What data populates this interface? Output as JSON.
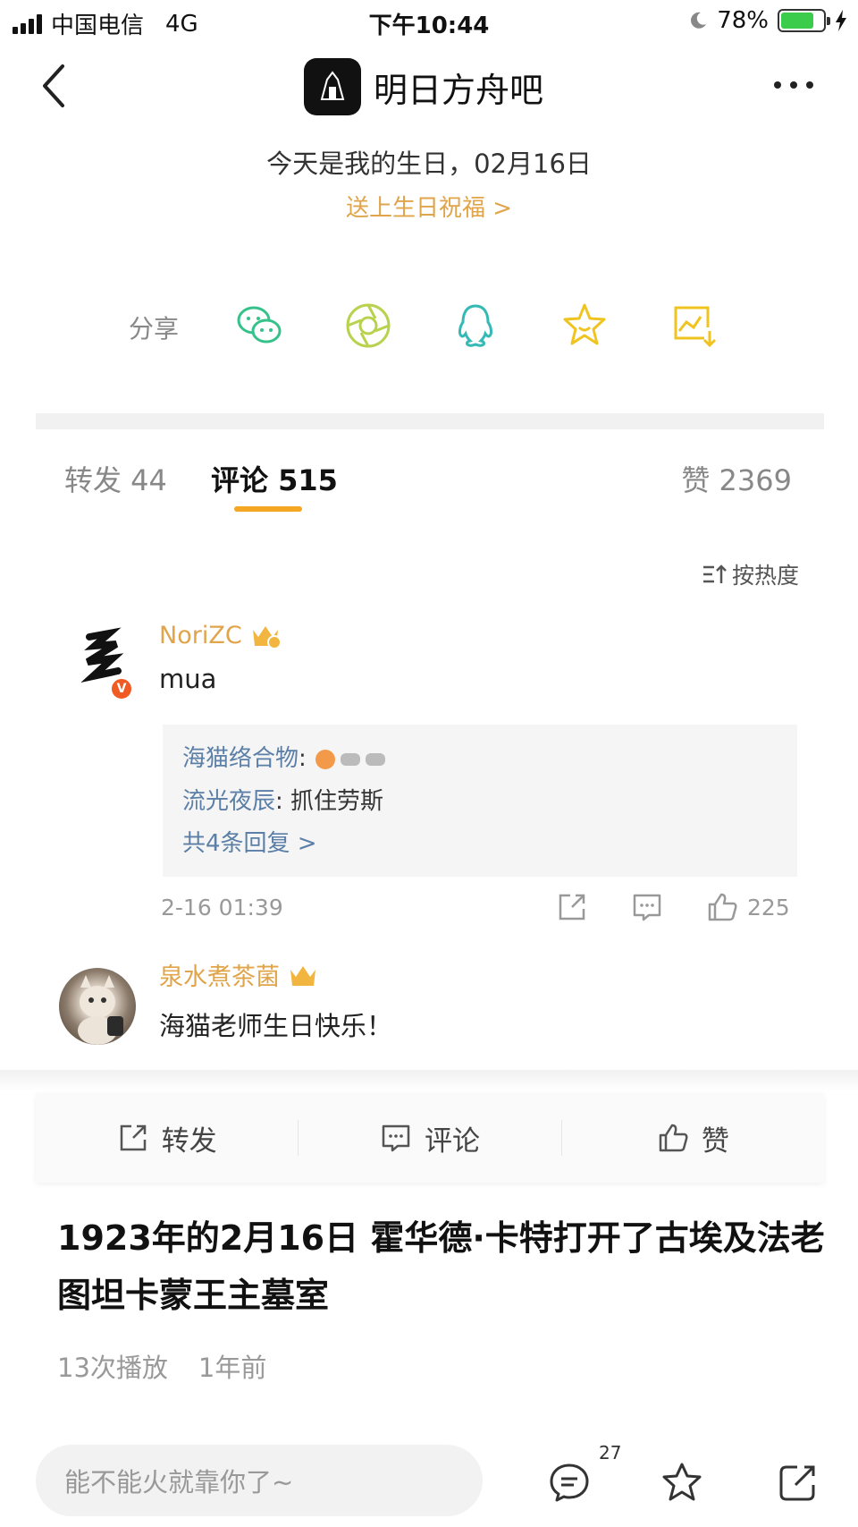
{
  "status_bar": {
    "carrier": "中国电信",
    "network": "4G",
    "time": "下午10:44",
    "battery": "78%",
    "battery_level": 0.78
  },
  "nav": {
    "title": "明日方舟吧"
  },
  "birthday": {
    "text": "今天是我的生日，02月16日",
    "link": "送上生日祝福 >"
  },
  "share": {
    "label": "分享",
    "icons": [
      "wechat-icon",
      "moments-icon",
      "qq-icon",
      "favorite-icon",
      "save-image-icon"
    ],
    "colors": {
      "green": "#35c28a",
      "lime": "#b8d24e",
      "teal": "#35b9b5",
      "yellow": "#f0c420"
    }
  },
  "tabs": {
    "repost": "转发 44",
    "comment": "评论 515",
    "like": "赞 2369"
  },
  "sort": {
    "label": "按热度"
  },
  "comments": [
    {
      "user": "NoriZC",
      "text": "mua",
      "replies": [
        {
          "name": "海猫络合物",
          "sep": ": ",
          "text": ""
        },
        {
          "name": "流光夜辰",
          "sep": ": ",
          "text": "抓住劳斯"
        }
      ],
      "more_replies": "共4条回复 >",
      "time": "2-16 01:39",
      "likes": "225"
    },
    {
      "user": "泉水煮茶菌",
      "text": "海猫老师生日快乐！"
    }
  ],
  "action_bar": {
    "repost": "转发",
    "comment": "评论",
    "like": "赞"
  },
  "article": {
    "title": "1923年的2月16日 霍华德·卡特打开了古埃及法老图坦卡蒙王主墓室",
    "plays": "13次播放",
    "ago": "1年前"
  },
  "footer": {
    "placeholder": "能不能火就靠你了~",
    "comment_count": "27"
  },
  "colors": {
    "accent": "#f5a623",
    "username": "#e0a44a",
    "link_blue": "#5b7fa6"
  }
}
